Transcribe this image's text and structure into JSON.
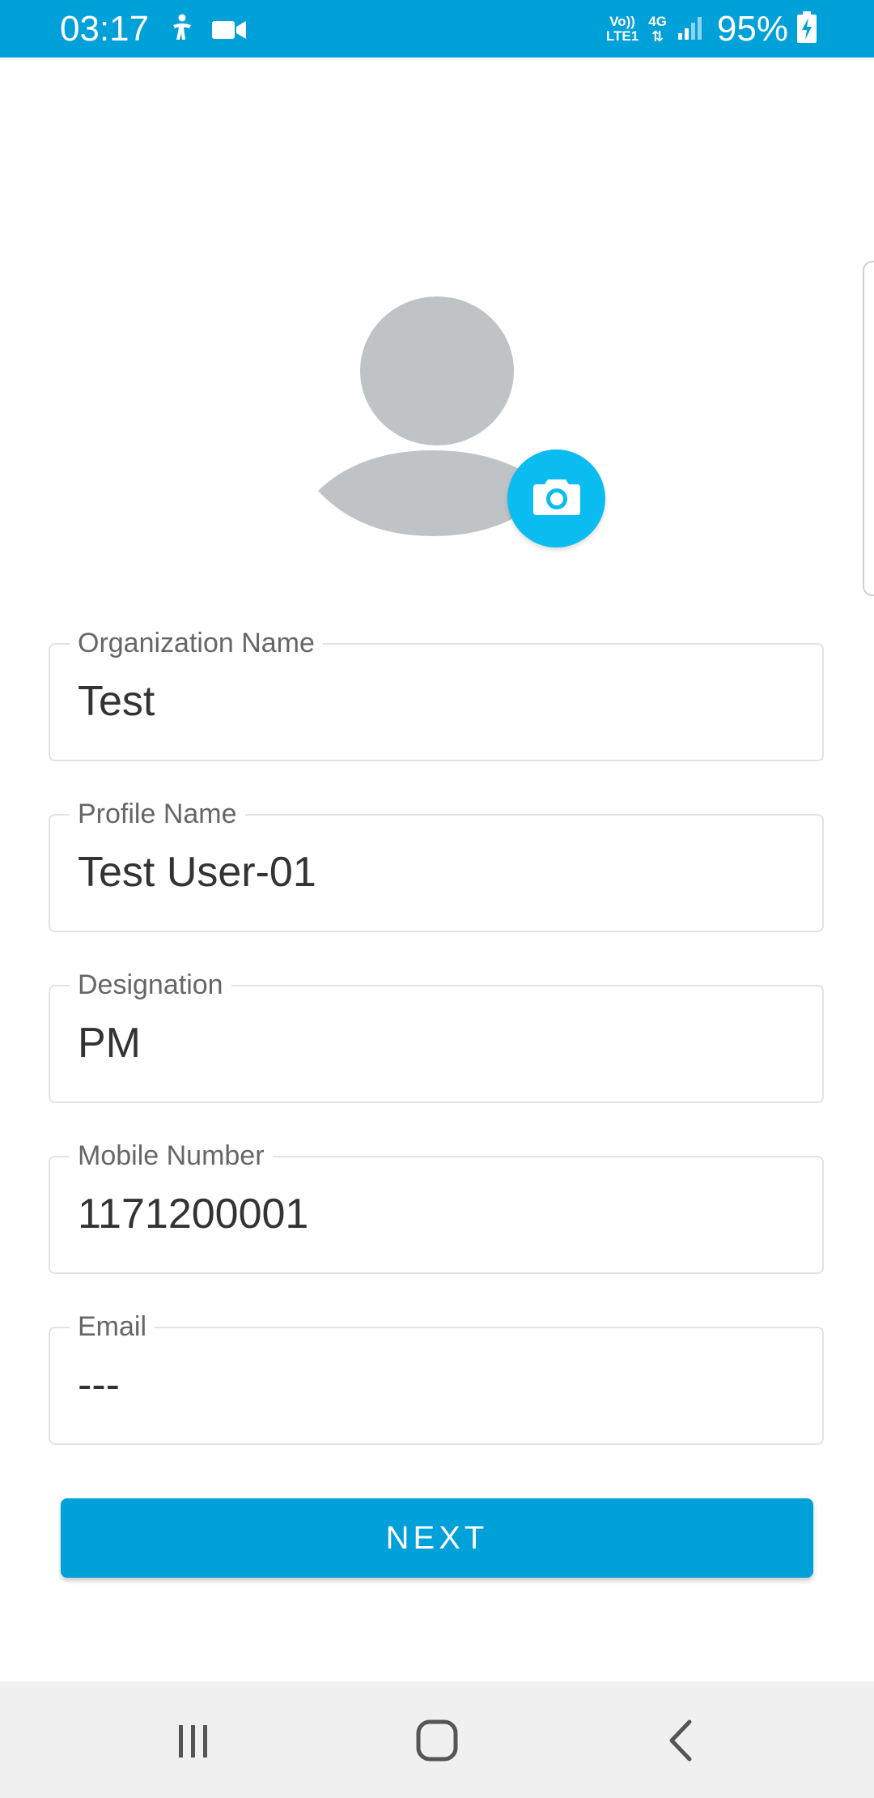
{
  "status_bar": {
    "time": "03:17",
    "network_top": "Vo))",
    "network_bottom": "LTE1",
    "network_type": "4G",
    "battery": "95%"
  },
  "avatar": {
    "icon": "person-placeholder-icon",
    "camera_icon": "camera-icon"
  },
  "form": {
    "fields": [
      {
        "label": "Organization Name",
        "value": "Test"
      },
      {
        "label": "Profile Name",
        "value": "Test User-01"
      },
      {
        "label": "Designation",
        "value": "PM"
      },
      {
        "label": "Mobile Number",
        "value": "1171200001"
      },
      {
        "label": "Email",
        "value": "---"
      }
    ],
    "next_label": "NEXT"
  },
  "nav": {
    "recent": "recent-apps-icon",
    "home": "home-icon",
    "back": "back-icon"
  },
  "colors": {
    "accent": "#00a0d8",
    "camera_button": "#0bbcf0",
    "avatar_placeholder": "#bfc3c6"
  }
}
